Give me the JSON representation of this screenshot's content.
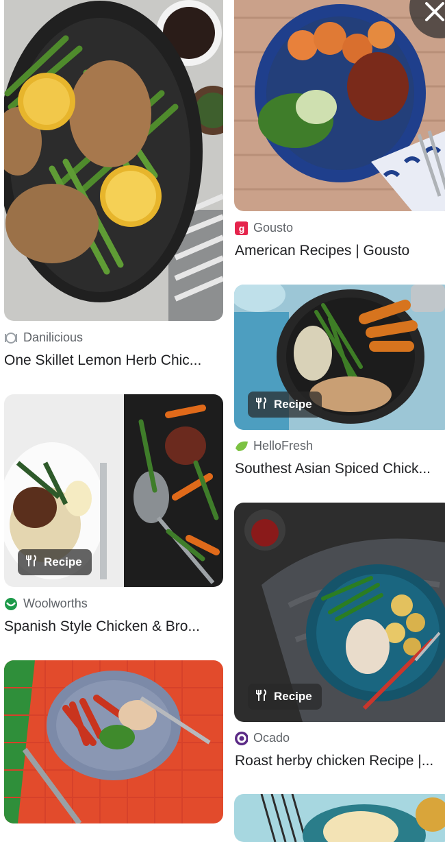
{
  "close_button": {
    "icon": "close-icon"
  },
  "left_column": [
    {
      "source": "Danilicious",
      "title": "One Skillet Lemon Herb Chic...",
      "icon": "plate-icon",
      "badge": ""
    },
    {
      "source": "Woolworths",
      "title": "Spanish Style Chicken & Bro...",
      "icon": "woolworths-icon",
      "badge": "Recipe"
    },
    {
      "source": "",
      "title": "",
      "icon": "",
      "badge": ""
    }
  ],
  "right_column": [
    {
      "source": "Gousto",
      "title": "American Recipes | Gousto",
      "icon": "gousto-icon",
      "badge": ""
    },
    {
      "source": "HelloFresh",
      "title": "Southest Asian Spiced Chick...",
      "icon": "hellofresh-icon",
      "badge": "Recipe"
    },
    {
      "source": "Ocado",
      "title": "Roast herby chicken Recipe |...",
      "icon": "ocado-icon",
      "badge": "Recipe"
    }
  ]
}
